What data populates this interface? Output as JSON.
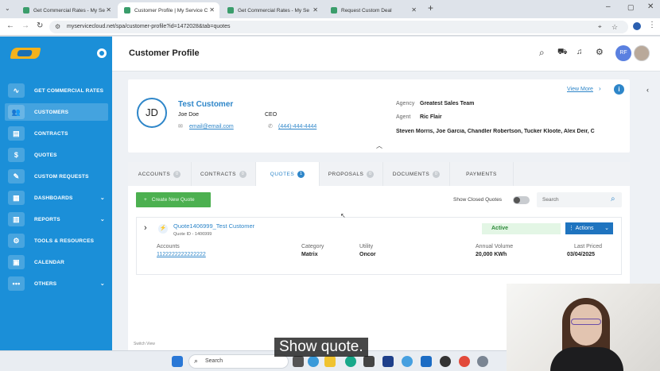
{
  "browser": {
    "tabs": [
      {
        "title": "Get Commercial Rates - My Se",
        "active": false
      },
      {
        "title": "Customer Profile | My Service C",
        "active": true
      },
      {
        "title": "Get Commercial Rates - My Se",
        "active": false
      },
      {
        "title": "Request Custom Deal",
        "active": false
      }
    ],
    "url": "myservicecloud.net/spa/customer-profile?id=1472028&tab=quotes"
  },
  "sidebar": {
    "items": [
      {
        "label": "GET COMMERCIAL RATES",
        "icon": "pulse-icon",
        "glyph": "∿",
        "chevron": false
      },
      {
        "label": "CUSTOMERS",
        "icon": "users-icon",
        "glyph": "👥",
        "chevron": false,
        "active": true
      },
      {
        "label": "CONTRACTS",
        "icon": "contract-icon",
        "glyph": "▤",
        "chevron": false
      },
      {
        "label": "QUOTES",
        "icon": "quote-icon",
        "glyph": "$",
        "chevron": false
      },
      {
        "label": "CUSTOM REQUESTS",
        "icon": "request-icon",
        "glyph": "✎",
        "chevron": false
      },
      {
        "label": "DASHBOARDS",
        "icon": "dashboard-icon",
        "glyph": "▦",
        "chevron": true
      },
      {
        "label": "REPORTS",
        "icon": "report-icon",
        "glyph": "▥",
        "chevron": true
      },
      {
        "label": "TOOLS & RESOURCES",
        "icon": "tools-icon",
        "glyph": "⚙",
        "chevron": false
      },
      {
        "label": "CALENDAR",
        "icon": "calendar-icon",
        "glyph": "▣",
        "chevron": false
      },
      {
        "label": "OTHERS",
        "icon": "more-icon",
        "glyph": "•••",
        "chevron": true
      }
    ]
  },
  "header": {
    "title": "Customer Profile",
    "avatar_initials": "RF"
  },
  "customer": {
    "initials": "JD",
    "name": "Test Customer",
    "contact_name": "Joe Doe",
    "contact_title": "CEO",
    "email": "email@email.com",
    "phone": "(444)-444-4444",
    "agency_label": "Agency",
    "agency": "Greatest Sales Team",
    "agent_label": "Agent",
    "agent": "Ric Flair",
    "team": "Steven Morris, Joe Garcia, Chandler Robertson, Tucker Kloote, Alex Deir, C",
    "view_more": "View More"
  },
  "profile_tabs": [
    {
      "label": "ACCOUNTS",
      "badge": "0",
      "active": false
    },
    {
      "label": "CONTRACTS",
      "badge": "0",
      "active": false
    },
    {
      "label": "QUOTES",
      "badge": "1",
      "active": true
    },
    {
      "label": "PROPOSALS",
      "badge": "0",
      "active": false
    },
    {
      "label": "DOCUMENTS",
      "badge": "0",
      "active": false
    },
    {
      "label": "PAYMENTS",
      "badge": "",
      "active": false
    }
  ],
  "quotes": {
    "create_button": "Create New Quote",
    "show_closed_label": "Show Closed Quotes",
    "search_placeholder": "Search",
    "items": [
      {
        "title": "Quote1406999_Test Customer",
        "quote_id": "Quote ID - 1406999",
        "status": "Active",
        "actions_label": "Actions",
        "accounts_label": "Accounts",
        "accounts_value": "1122222222222222",
        "category_label": "Category",
        "category_value": "Matrix",
        "utility_label": "Utility",
        "utility_value": "Oncor",
        "annual_volume_label": "Annual Volume",
        "annual_volume_value": "20,000 KWh",
        "last_priced_label": "Last Priced",
        "last_priced_value": "03/04/2025"
      }
    ],
    "switch_view": "Switch View"
  },
  "taskbar": {
    "search_placeholder": "Search"
  },
  "caption": "Show quote.",
  "colors": {
    "sidebar": "#1b8fd8",
    "accent": "#2e86c9",
    "create_button": "#4cb050",
    "active_status": "#e3f6e5",
    "actions_button": "#1f74bf"
  }
}
